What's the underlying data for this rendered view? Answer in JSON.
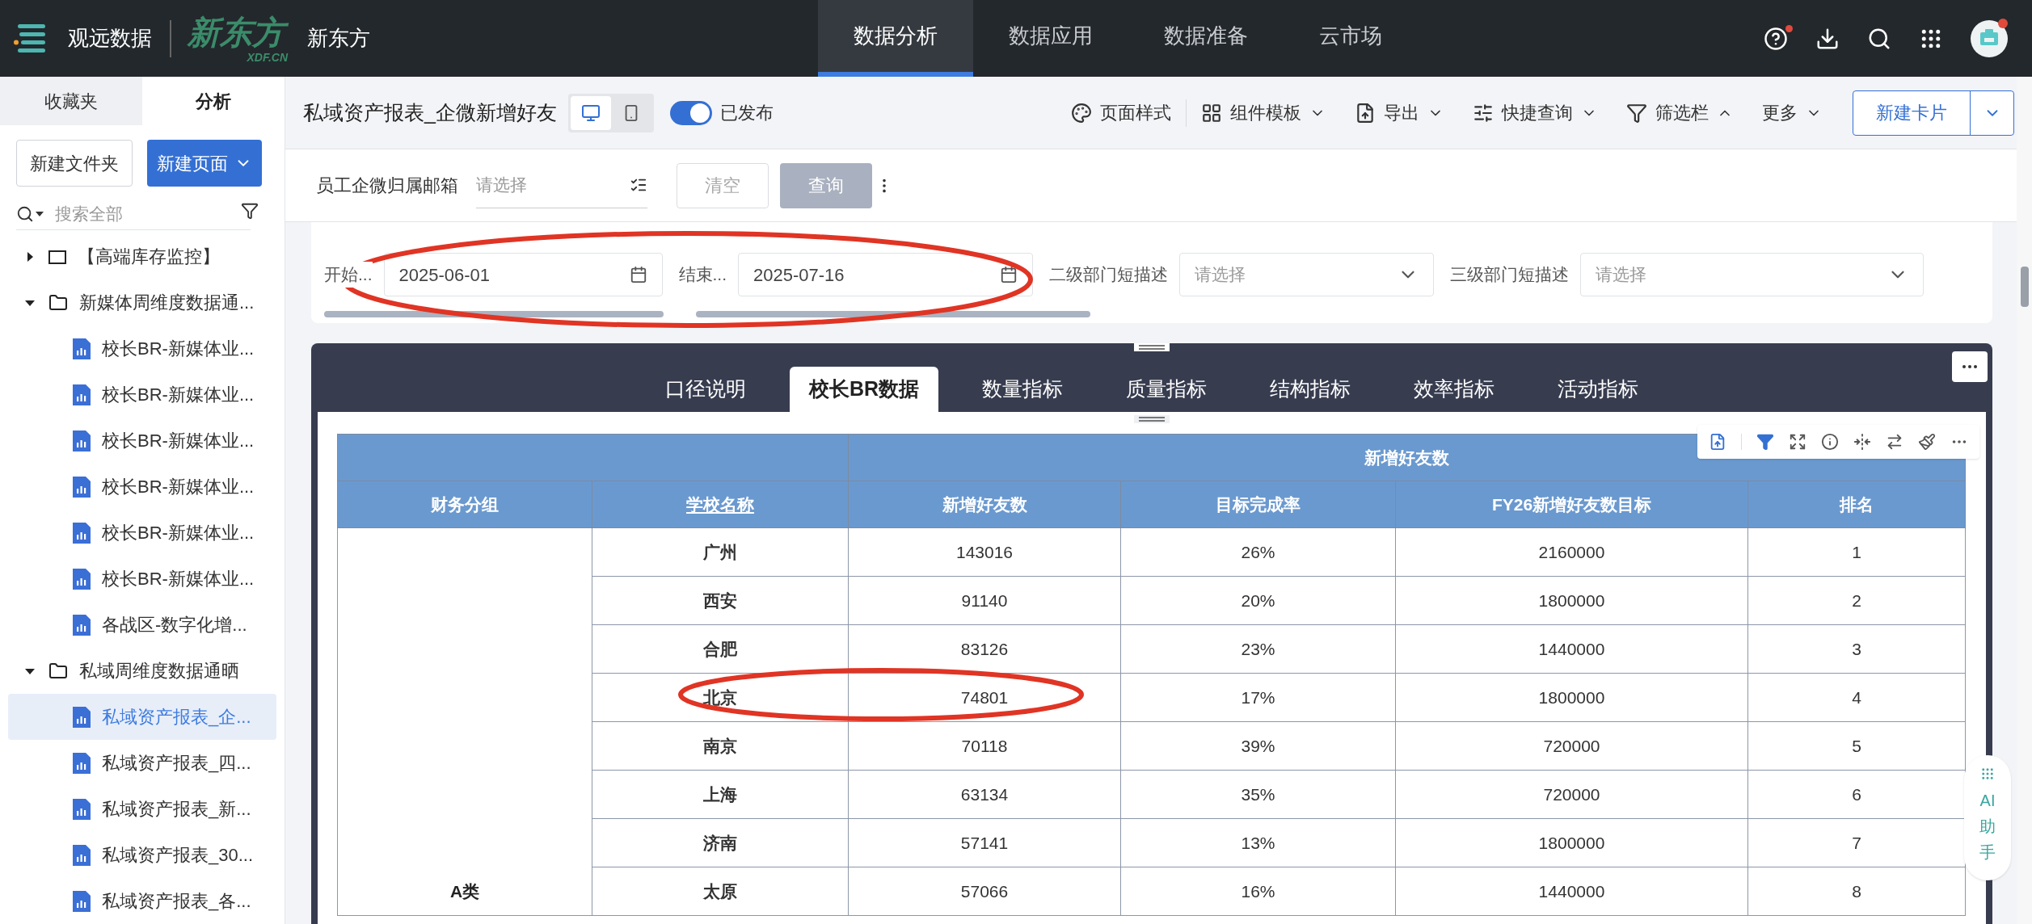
{
  "topbar": {
    "product": "观远数据",
    "logo": {
      "mark": "新东方",
      "sub": "XDF.CN"
    },
    "org": "新东方",
    "nav": [
      {
        "label": "数据分析",
        "selected": true
      },
      {
        "label": "数据应用",
        "selected": false
      },
      {
        "label": "数据准备",
        "selected": false
      },
      {
        "label": "云市场",
        "selected": false
      }
    ],
    "help_badge": true,
    "avatar_badge": true
  },
  "sidebar": {
    "tabs": [
      {
        "label": "收藏夹",
        "selected": false
      },
      {
        "label": "分析",
        "selected": true
      }
    ],
    "new_folder": "新建文件夹",
    "new_page": "新建页面",
    "search": {
      "placeholder": "搜索全部"
    },
    "tree": [
      {
        "label": "【高端库存监控】",
        "kind": "folder",
        "expanded": false,
        "selected": false
      },
      {
        "label": "新媒体周维度数据通...",
        "kind": "folder",
        "expanded": true,
        "selected": false,
        "children": [
          {
            "label": "校长BR-新媒体业...",
            "kind": "page",
            "selected": false
          },
          {
            "label": "校长BR-新媒体业...",
            "kind": "page",
            "selected": false
          },
          {
            "label": "校长BR-新媒体业...",
            "kind": "page",
            "selected": false
          },
          {
            "label": "校长BR-新媒体业...",
            "kind": "page",
            "selected": false
          },
          {
            "label": "校长BR-新媒体业...",
            "kind": "page",
            "selected": false
          },
          {
            "label": "校长BR-新媒体业...",
            "kind": "page",
            "selected": false
          },
          {
            "label": "各战区-数字化增...",
            "kind": "page",
            "selected": false
          }
        ]
      },
      {
        "label": "私域周维度数据通晒",
        "kind": "folder",
        "expanded": true,
        "selected": false,
        "children": [
          {
            "label": "私域资产报表_企...",
            "kind": "page",
            "selected": true
          },
          {
            "label": "私域资产报表_四...",
            "kind": "page",
            "selected": false
          },
          {
            "label": "私域资产报表_新...",
            "kind": "page",
            "selected": false
          },
          {
            "label": "私域资产报表_30...",
            "kind": "page",
            "selected": false
          },
          {
            "label": "私域资产报表_各...",
            "kind": "page",
            "selected": false
          }
        ]
      }
    ]
  },
  "page": {
    "title": "私域资产报表_企微新增好友",
    "view_modes": [
      {
        "kind": "desktop",
        "selected": true
      },
      {
        "kind": "mobile",
        "selected": false
      }
    ],
    "published": {
      "label": "已发布",
      "on": true
    },
    "toolbar": [
      {
        "label": "页面样式",
        "kind": "palette",
        "dropdown": false
      },
      {
        "label": "组件模板",
        "kind": "template",
        "dropdown": true,
        "expanded": false
      },
      {
        "label": "导出",
        "kind": "export",
        "dropdown": true,
        "expanded": false
      },
      {
        "label": "快捷查询",
        "kind": "sliders",
        "dropdown": true,
        "expanded": false
      },
      {
        "label": "筛选栏",
        "kind": "filter",
        "dropdown": true,
        "expanded": true
      },
      {
        "label": "更多",
        "kind": "more",
        "dropdown": true,
        "expanded": false
      }
    ],
    "new_card": "新建卡片"
  },
  "filter_bar": {
    "label": "员工企微归属邮箱",
    "placeholder": "请选择",
    "clear": "清空",
    "query": "查询"
  },
  "filters": [
    {
      "label": "开始...",
      "kind": "date",
      "value": "2025-06-01"
    },
    {
      "label": "结束...",
      "kind": "date",
      "value": "2025-07-16"
    },
    {
      "label": "二级部门短描述",
      "kind": "select",
      "placeholder": "请选择"
    },
    {
      "label": "三级部门短描述",
      "kind": "select",
      "placeholder": "请选择"
    }
  ],
  "card": {
    "tabs": [
      {
        "label": "口径说明",
        "selected": false
      },
      {
        "label": "校长BR数据",
        "selected": true
      },
      {
        "label": "数量指标",
        "selected": false
      },
      {
        "label": "质量指标",
        "selected": false
      },
      {
        "label": "结构指标",
        "selected": false
      },
      {
        "label": "效率指标",
        "selected": false
      },
      {
        "label": "活动指标",
        "selected": false
      }
    ],
    "table": {
      "group_header": "新增好友数",
      "columns": [
        {
          "label": "财务分组",
          "link": false
        },
        {
          "label": "学校名称",
          "link": true
        },
        {
          "label": "新增好友数",
          "link": false
        },
        {
          "label": "目标完成率",
          "link": false
        },
        {
          "label": "FY26新增好友数目标",
          "link": false
        },
        {
          "label": "排名",
          "link": false
        }
      ],
      "rows": [
        [
          "",
          "广州",
          "143016",
          "26%",
          "2160000",
          "1"
        ],
        [
          "",
          "西安",
          "91140",
          "20%",
          "1800000",
          "2"
        ],
        [
          "",
          "合肥",
          "83126",
          "23%",
          "1440000",
          "3"
        ],
        [
          "",
          "北京",
          "74801",
          "17%",
          "1800000",
          "4"
        ],
        [
          "",
          "南京",
          "70118",
          "39%",
          "720000",
          "5"
        ],
        [
          "",
          "上海",
          "63134",
          "35%",
          "720000",
          "6"
        ],
        [
          "",
          "济南",
          "57141",
          "13%",
          "1800000",
          "7"
        ],
        [
          "A类",
          "太原",
          "57066",
          "16%",
          "1440000",
          "8"
        ]
      ]
    }
  },
  "ai_assistant": {
    "label": "AI助手"
  }
}
